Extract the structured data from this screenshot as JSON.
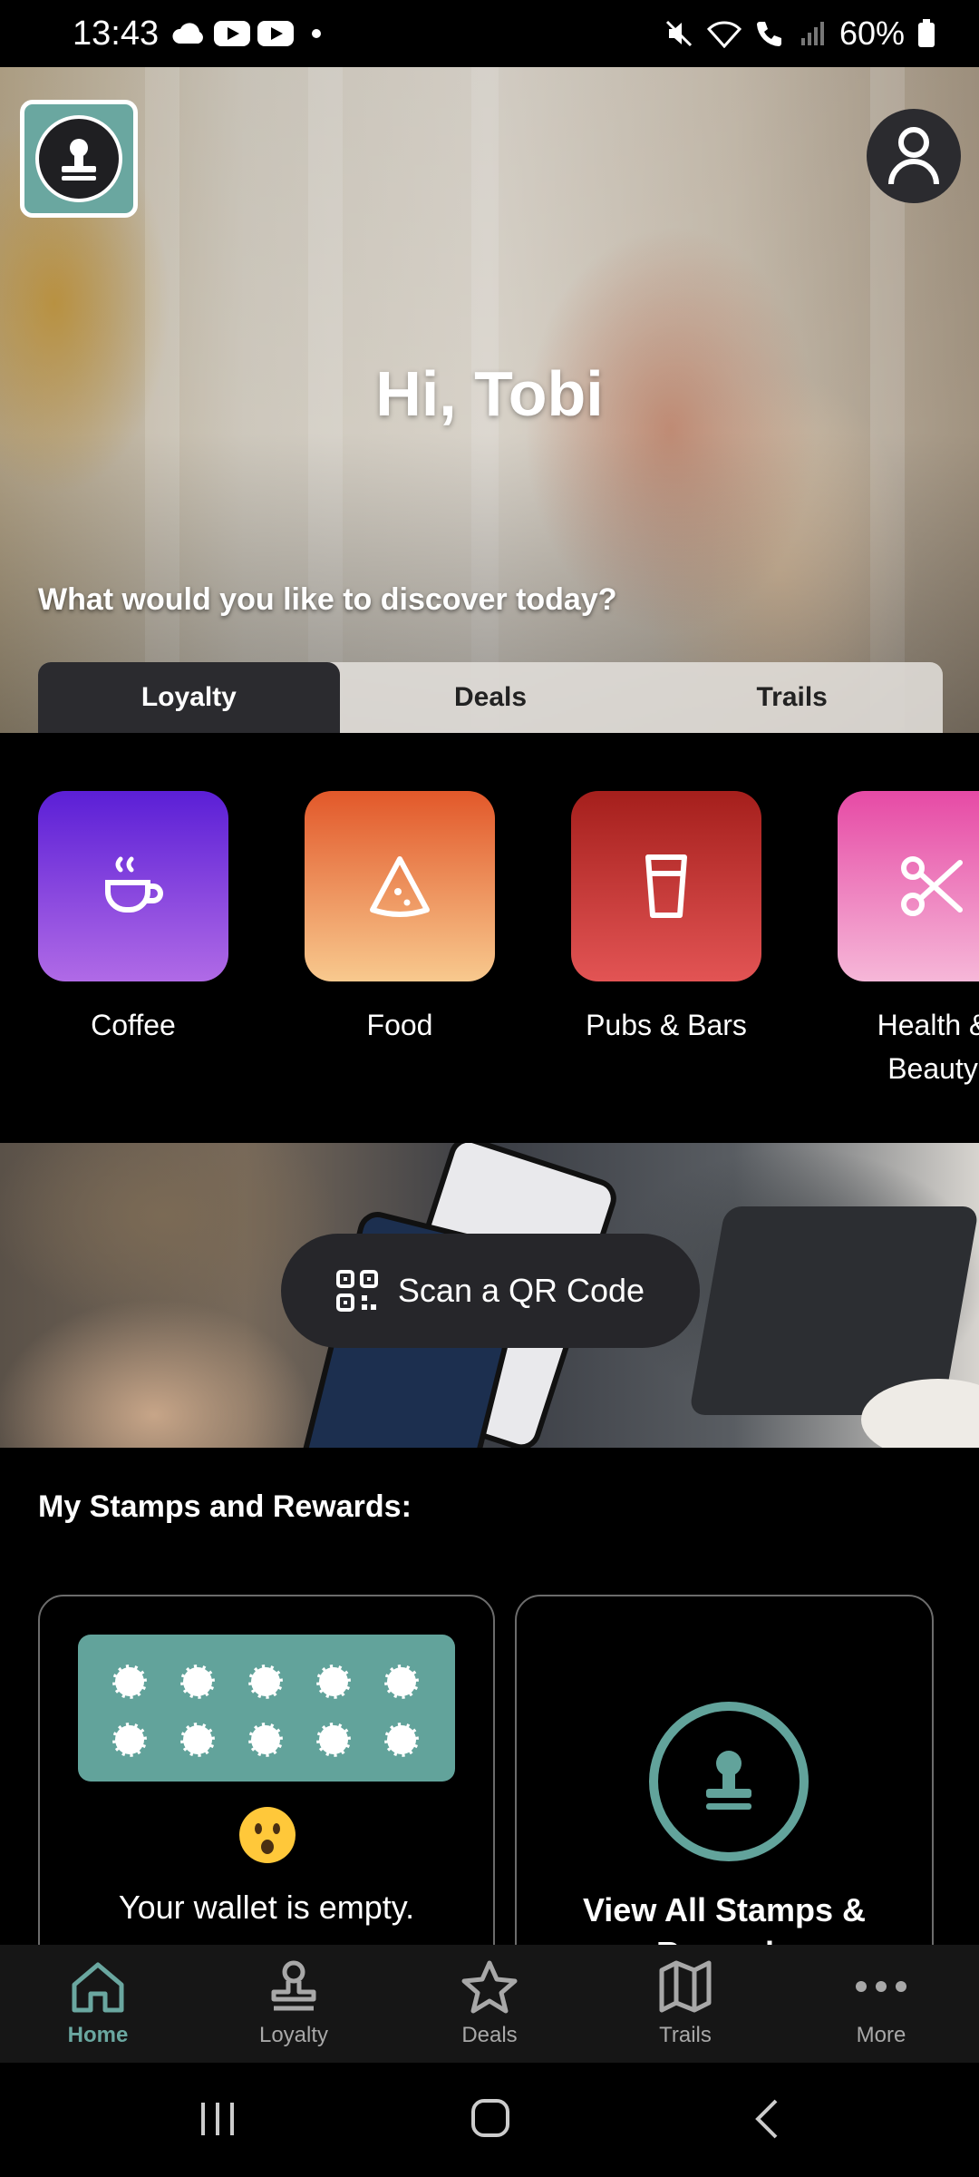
{
  "status_bar": {
    "time": "13:43",
    "battery": "60%"
  },
  "hero": {
    "greeting": "Hi, Tobi",
    "question": "What would you like to discover today?",
    "tabs": [
      {
        "label": "Loyalty",
        "active": true
      },
      {
        "label": "Deals",
        "active": false
      },
      {
        "label": "Trails",
        "active": false
      }
    ]
  },
  "categories": [
    {
      "label": "Coffee",
      "icon": "coffee-cup-icon",
      "colors": [
        "#5b1fd6",
        "#b06ae6"
      ]
    },
    {
      "label": "Food",
      "icon": "pizza-slice-icon",
      "colors": [
        "#e2582a",
        "#f8c98e"
      ]
    },
    {
      "label": "Pubs & Bars",
      "icon": "pint-glass-icon",
      "colors": [
        "#a51f1c",
        "#e25454"
      ]
    },
    {
      "label": "Health & Beauty",
      "icon": "scissors-icon",
      "colors": [
        "#e64aa5",
        "#f6b7d8"
      ]
    }
  ],
  "scan": {
    "label": "Scan a QR Code"
  },
  "stamps": {
    "title": "My Stamps and Rewards:",
    "wallet_text": "Your wallet is empty.",
    "view_all_text": "View All Stamps & Rewards"
  },
  "bottom_nav": [
    {
      "label": "Home",
      "icon": "home-icon",
      "active": true
    },
    {
      "label": "Loyalty",
      "icon": "stamp-icon",
      "active": false
    },
    {
      "label": "Deals",
      "icon": "star-icon",
      "active": false
    },
    {
      "label": "Trails",
      "icon": "map-icon",
      "active": false
    },
    {
      "label": "More",
      "icon": "more-dots-icon",
      "active": false
    }
  ],
  "colors": {
    "accent": "#6aa7a0",
    "background": "#000000",
    "card_border": "#6c6c6c"
  }
}
